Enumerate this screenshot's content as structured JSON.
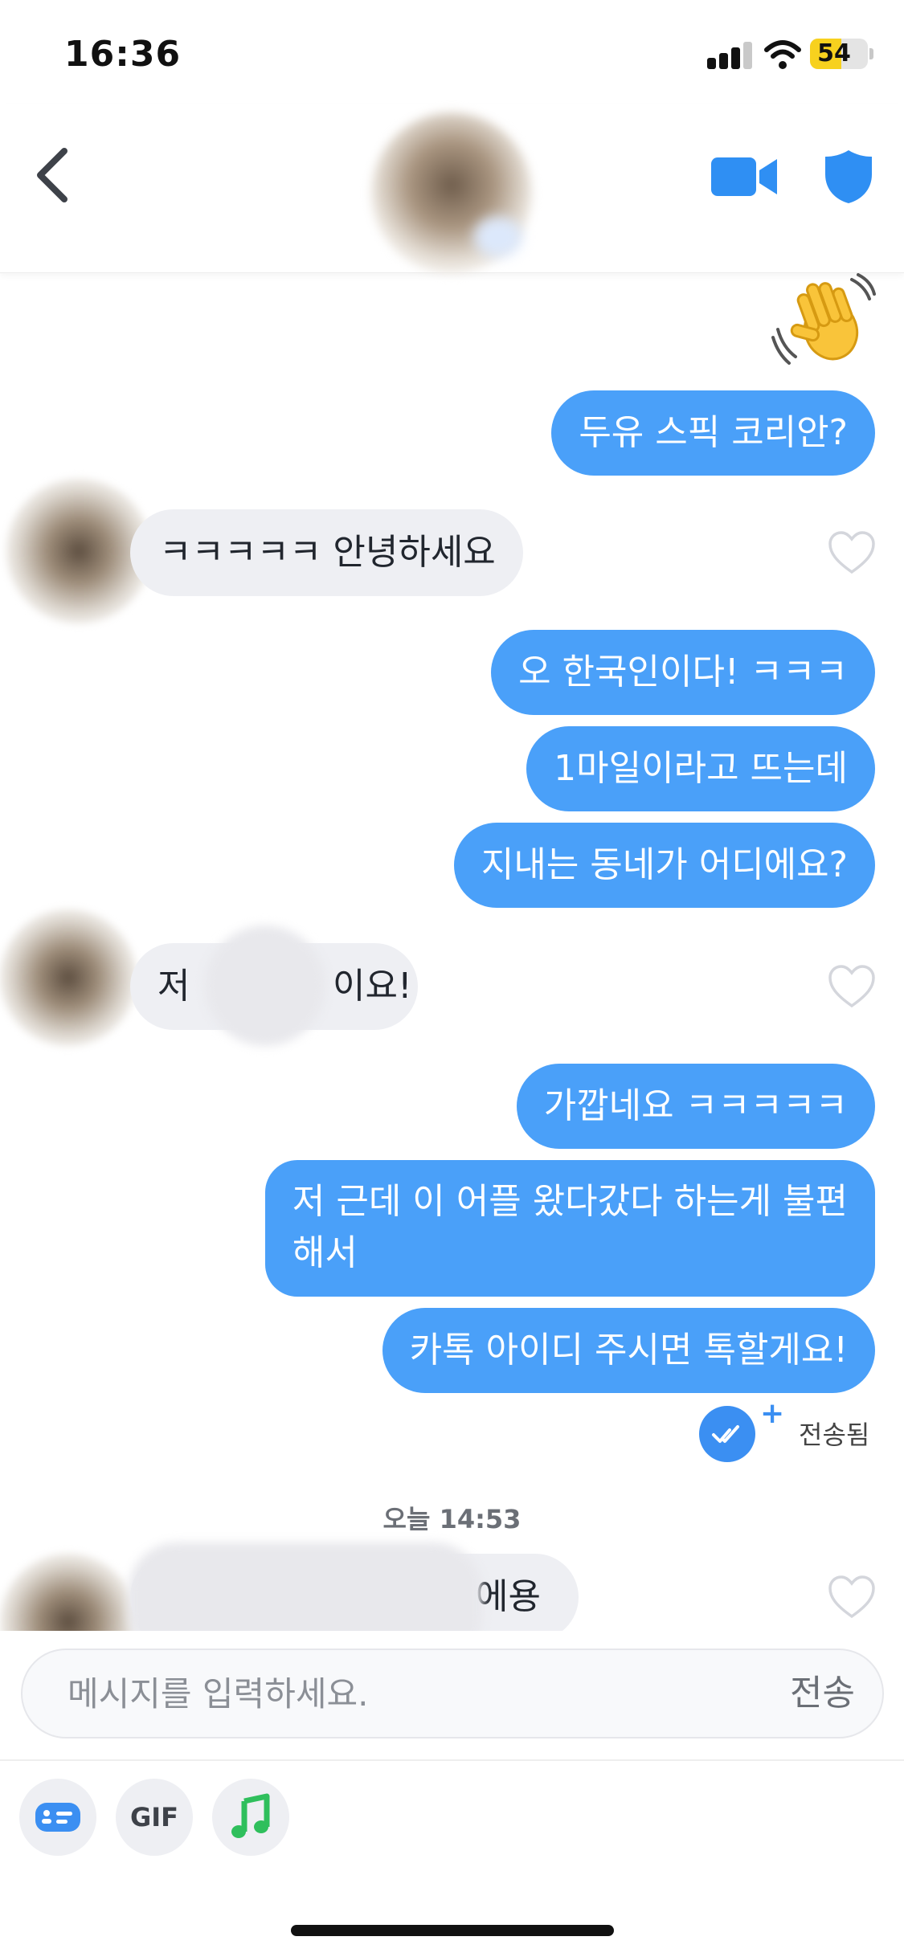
{
  "status_bar": {
    "time": "16:36",
    "battery": "54",
    "battery_level": 0.54
  },
  "header": {
    "back_icon": "chevron-left-icon",
    "video_icon": "video-camera-icon",
    "shield_icon": "shield-icon"
  },
  "messages": [
    {
      "direction": "out",
      "type": "emoji",
      "icon": "waving-hand-emoji"
    },
    {
      "direction": "out",
      "text": "두유 스픽 코리안?"
    },
    {
      "direction": "in",
      "text": "ㅋㅋㅋㅋㅋ 안녕하세요"
    },
    {
      "direction": "out",
      "text": "오 한국인이다! ㅋㅋㅋ"
    },
    {
      "direction": "out",
      "text": "1마일이라고 뜨는데"
    },
    {
      "direction": "out",
      "text": "지내는 동네가 어디에요?"
    },
    {
      "direction": "in",
      "text_start": "저",
      "text_end": "이요!"
    },
    {
      "direction": "out",
      "text": "가깝네요 ㅋㅋㅋㅋㅋ"
    },
    {
      "direction": "out",
      "text_line1": "저 근데 이 어플 왔다갔다 하는게 불편",
      "text_line2": "해서"
    },
    {
      "direction": "out",
      "text": "카톡 아이디 주시면 톡할게요!"
    },
    {
      "direction": "in",
      "text_end": "에용"
    }
  ],
  "delivery_status": "전송됨",
  "timestamp": "오늘 14:53",
  "composer": {
    "placeholder": "메시지를 입력하세요.",
    "send_label": "전송"
  },
  "toolbar": {
    "gif_label": "GIF",
    "icons": [
      "message-card-icon",
      "gif-icon",
      "music-note-icon"
    ]
  },
  "colors": {
    "outgoing": "#4aa0f9",
    "incoming": "#eeeff3",
    "accent": "#3b8ff2",
    "music": "#2fbf5c"
  }
}
